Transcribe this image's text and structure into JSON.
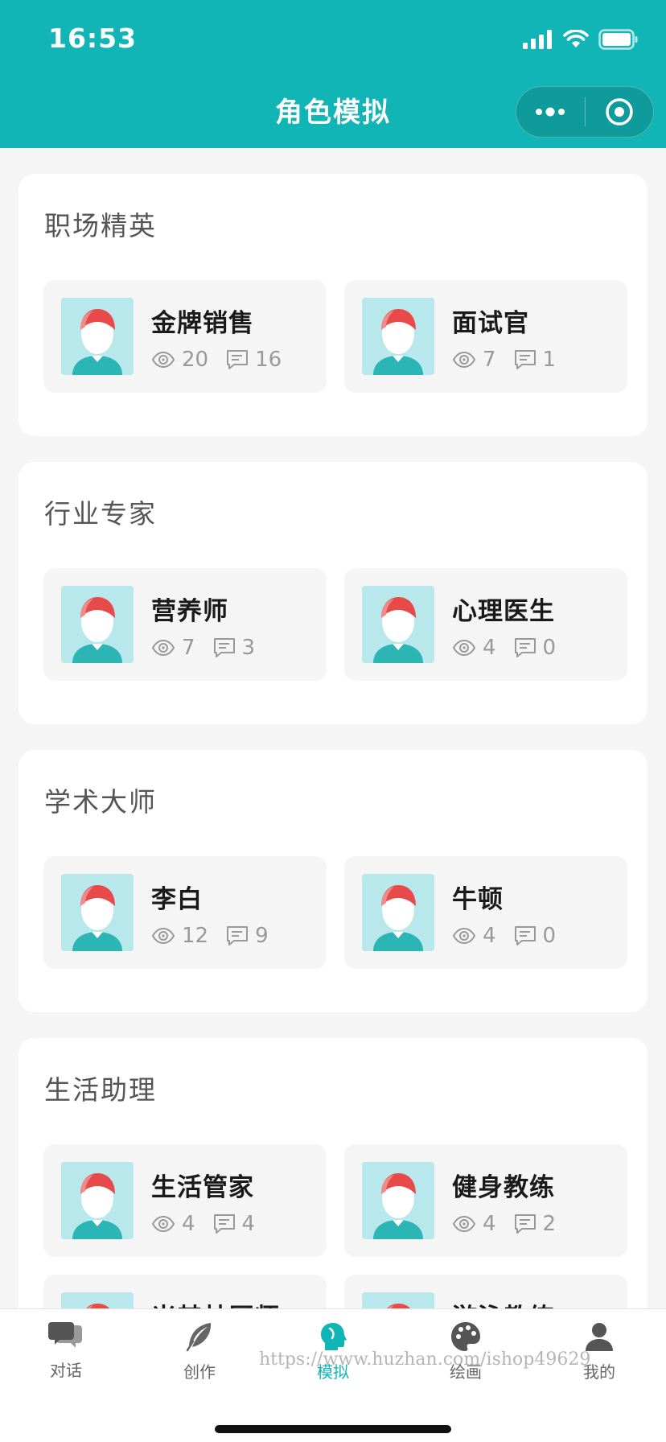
{
  "status_bar": {
    "time": "16:53"
  },
  "nav": {
    "title": "角色模拟"
  },
  "sections": [
    {
      "title": "职场精英",
      "cards": [
        {
          "name": "金牌销售",
          "views": "20",
          "comments": "16"
        },
        {
          "name": "面试官",
          "views": "7",
          "comments": "1"
        }
      ]
    },
    {
      "title": "行业专家",
      "cards": [
        {
          "name": "营养师",
          "views": "7",
          "comments": "3"
        },
        {
          "name": "心理医生",
          "views": "4",
          "comments": "0"
        }
      ]
    },
    {
      "title": "学术大师",
      "cards": [
        {
          "name": "李白",
          "views": "12",
          "comments": "9"
        },
        {
          "name": "牛顿",
          "views": "4",
          "comments": "0"
        }
      ]
    },
    {
      "title": "生活助理",
      "cards": [
        {
          "name": "生活管家",
          "views": "4",
          "comments": "4"
        },
        {
          "name": "健身教练",
          "views": "4",
          "comments": "2"
        },
        {
          "name": "米其林厨师",
          "views": "",
          "comments": ""
        },
        {
          "name": "游泳教练",
          "views": "",
          "comments": ""
        }
      ]
    }
  ],
  "tabbar": {
    "items": [
      {
        "label": "对话",
        "icon": "chat-bubbles-icon"
      },
      {
        "label": "创作",
        "icon": "feather-icon"
      },
      {
        "label": "模拟",
        "icon": "head-silhouette-icon",
        "active": true
      },
      {
        "label": "绘画",
        "icon": "palette-icon"
      },
      {
        "label": "我的",
        "icon": "person-icon"
      }
    ]
  },
  "watermark": "https://www.huzhan.com/ishop49629",
  "colors": {
    "brand": "#12b5b6",
    "avatar_bg": "#b8e8ec",
    "hair": "#e84a4a"
  }
}
